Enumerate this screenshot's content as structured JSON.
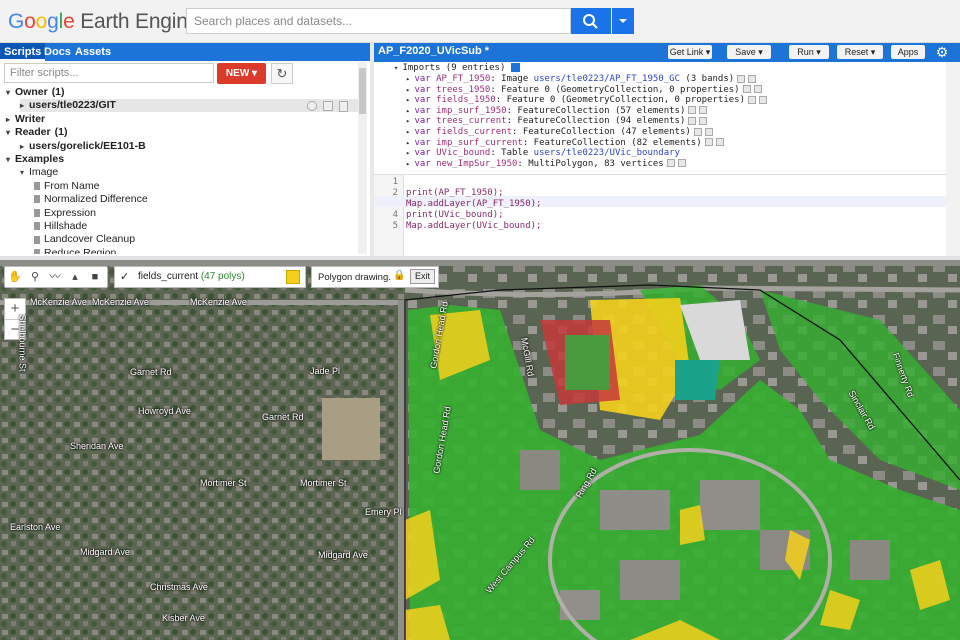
{
  "header": {
    "logo_google": "Google",
    "logo_product": "Earth Engine",
    "search_placeholder": "Search places and datasets..."
  },
  "left_tabs": [
    "Scripts",
    "Docs",
    "Assets"
  ],
  "scripts": {
    "filter_placeholder": "Filter scripts...",
    "new_label": "NEW",
    "tree": [
      {
        "label": "Owner",
        "count": "(1)",
        "level": 0,
        "bold": true,
        "arrow": "▾"
      },
      {
        "label": "users/tle0223/GIT",
        "level": 1,
        "bold": true,
        "arrow": "▸"
      },
      {
        "label": "Writer",
        "level": 0,
        "bold": true,
        "arrow": "▸"
      },
      {
        "label": "Reader",
        "count": "(1)",
        "level": 0,
        "bold": true,
        "arrow": "▾"
      },
      {
        "label": "users/gorelick/EE101-B",
        "level": 1,
        "bold": true,
        "arrow": "▸"
      },
      {
        "label": "Examples",
        "level": 0,
        "bold": true,
        "arrow": "▾"
      },
      {
        "label": "Image",
        "level": 1,
        "bold": false,
        "arrow": "▾"
      },
      {
        "label": "From Name",
        "level": 2,
        "bold": false,
        "arrow": ""
      },
      {
        "label": "Normalized Difference",
        "level": 2,
        "bold": false,
        "arrow": ""
      },
      {
        "label": "Expression",
        "level": 2,
        "bold": false,
        "arrow": ""
      },
      {
        "label": "Hillshade",
        "level": 2,
        "bold": false,
        "arrow": ""
      },
      {
        "label": "Landcover Cleanup",
        "level": 2,
        "bold": false,
        "arrow": ""
      },
      {
        "label": "Reduce Region",
        "level": 2,
        "bold": false,
        "arrow": ""
      }
    ]
  },
  "editor": {
    "title": "AP_F2020_UVicSub *",
    "buttons": [
      "Get Link",
      "Save",
      "Run",
      "Reset",
      "Apps"
    ],
    "imports_header": "Imports (9 entries)",
    "imports": [
      {
        "name": "AP_FT_1950",
        "desc": "Image",
        "link": "users/tle0223/AP_FT_1950_GC",
        "tail": "(3 bands)"
      },
      {
        "name": "trees_1950",
        "desc": "Feature 0 (GeometryCollection, 0 properties)",
        "link": "",
        "tail": ""
      },
      {
        "name": "fields_1950",
        "desc": "Feature 0 (GeometryCollection, 0 properties)",
        "link": "",
        "tail": ""
      },
      {
        "name": "imp_surf_1950",
        "desc": "FeatureCollection (57 elements)",
        "link": "",
        "tail": ""
      },
      {
        "name": "trees_current",
        "desc": "FeatureCollection (94 elements)",
        "link": "",
        "tail": ""
      },
      {
        "name": "fields_current",
        "desc": "FeatureCollection (47 elements)",
        "link": "",
        "tail": ""
      },
      {
        "name": "imp_surf_current",
        "desc": "FeatureCollection (82 elements)",
        "link": "",
        "tail": ""
      },
      {
        "name": "UVic_bound",
        "desc": "Table",
        "link": "users/tle0223/UVic_boundary",
        "tail": ""
      },
      {
        "name": "new_ImpSur_1950",
        "desc": "MultiPolygon, 83 vertices",
        "link": "",
        "tail": ""
      }
    ],
    "code_lines": [
      "",
      "print(AP_FT_1950);",
      "Map.addLayer(AP_FT_1950);",
      "print(UVic_bound);",
      "Map.addLayer(UVic_bound);"
    ],
    "line_numbers": [
      "1",
      "2",
      "3",
      "4",
      "5"
    ],
    "var_keyword": "var"
  },
  "map": {
    "layer_name": "fields_current",
    "layer_count": "(47 polys)",
    "drawing_label": "Polygon drawing.",
    "exit_label": "Exit",
    "zoom_in": "+",
    "zoom_out": "−",
    "streets": [
      "McKenzie Ave",
      "McKenzie Ave",
      "McKenzie Ave",
      "Garnet Rd",
      "Jade Pl",
      "Howroyd Ave",
      "Garnet Rd",
      "Sheridan Ave",
      "Mortimer St",
      "Mortimer St",
      "Emery Pl",
      "Earlston Ave",
      "Christmas Ave",
      "Kisber Ave",
      "Midgard Ave",
      "Midgard Ave",
      "Shelbourne St",
      "Gordon Head Rd",
      "Gordon Head Rd",
      "McGill Rd",
      "Ring Rd",
      "Sinclair Rd",
      "Finnerty Rd",
      "West Campus Rd"
    ]
  },
  "colors": {
    "accent": "#1c73d8",
    "new_button": "#db3b2a",
    "fields_layer": "#f4d01c",
    "trees_layer": "#35b030"
  }
}
